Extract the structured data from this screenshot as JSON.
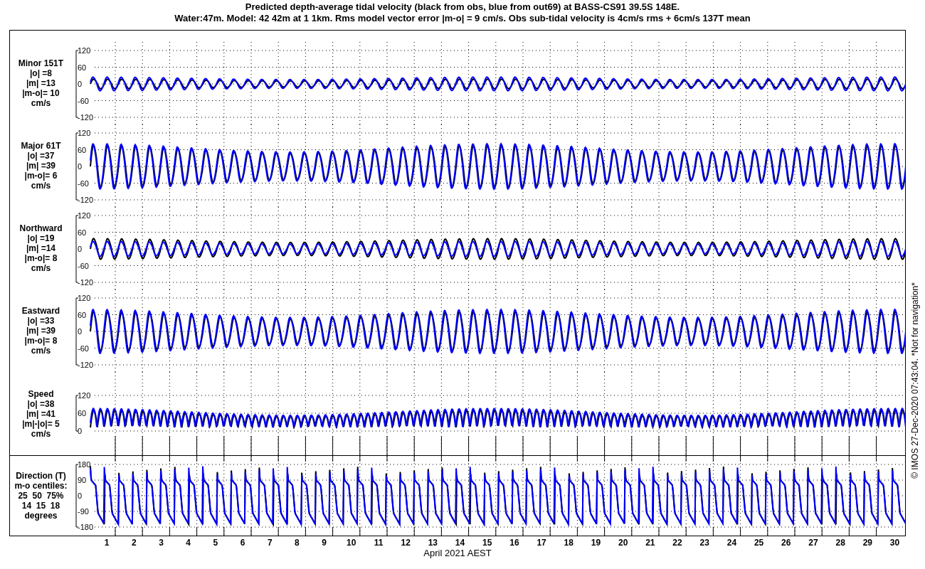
{
  "title_lines": [
    "Predicted depth-average tidal velocity (black from obs, blue from out69) at BASS-CS91 39.5S 148E.",
    "Water:47m. Model: 42 42m at 1 1km. Rms model vector error |m-o| = 9 cm/s. Obs sub-tidal velocity is 4cm/s rms + 6cm/s 137T mean"
  ],
  "panels": [
    {
      "kind": "velocity",
      "label_lines": [
        "Minor 151T",
        "|o| =8",
        "|m| =13",
        "|m-o|= 10",
        "cm/s"
      ],
      "yticks": [
        "120",
        "60",
        "0",
        "-60",
        "-120"
      ]
    },
    {
      "kind": "velocity",
      "label_lines": [
        "Major 61T",
        "|o| =37",
        "|m| =39",
        "|m-o|= 6",
        "cm/s"
      ],
      "yticks": [
        "120",
        "60",
        "0",
        "-60",
        "-120"
      ]
    },
    {
      "kind": "velocity",
      "label_lines": [
        "Northward",
        "|o| =19",
        "|m| =14",
        "|m-o|= 8",
        "cm/s"
      ],
      "yticks": [
        "120",
        "60",
        "0",
        "-60",
        "-120"
      ]
    },
    {
      "kind": "velocity",
      "label_lines": [
        "Eastward",
        "|o| =33",
        "|m| =39",
        "|m-o|= 8",
        "cm/s"
      ],
      "yticks": [
        "120",
        "60",
        "0",
        "-60",
        "-120"
      ]
    },
    {
      "kind": "speed",
      "label_lines": [
        "Speed",
        "|o| =38",
        "|m| =41",
        "|m|-|o|= 5",
        "cm/s"
      ],
      "yticks": [
        "120",
        "60",
        "0"
      ]
    },
    {
      "kind": "direction",
      "label_lines": [
        "Direction (T)",
        "m-o centiles:",
        "25  50  75%",
        "14  15  18",
        "degrees"
      ],
      "yticks": [
        "180",
        "90",
        "0",
        "-90",
        "-180"
      ]
    }
  ],
  "xticks": [
    "1",
    "2",
    "3",
    "4",
    "5",
    "6",
    "7",
    "8",
    "9",
    "10",
    "11",
    "12",
    "13",
    "14",
    "15",
    "16",
    "17",
    "18",
    "19",
    "20",
    "21",
    "22",
    "23",
    "24",
    "25",
    "26",
    "27",
    "28",
    "29",
    "30"
  ],
  "xlabel": "April 2021 AEST",
  "credit": "© IMOS 27-Dec-2020 07:43:04. *Not for navigation*"
}
